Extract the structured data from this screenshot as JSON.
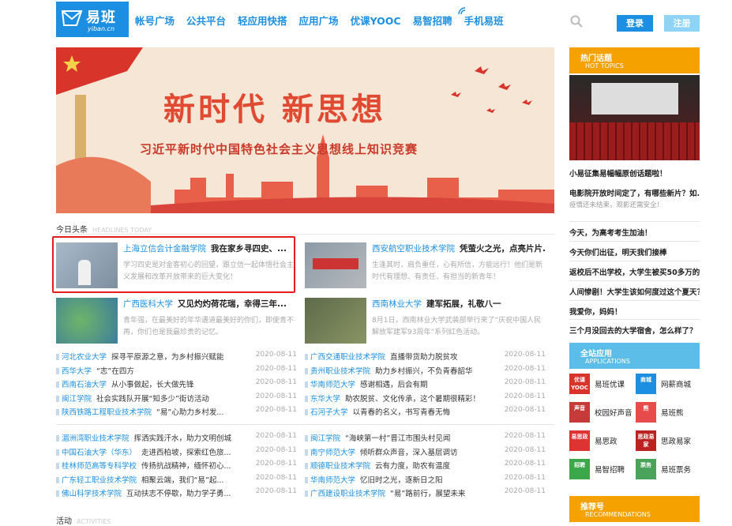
{
  "header": {
    "logo_text": "易班",
    "logo_sub": "yiban.cn",
    "nav": [
      "帐号广场",
      "公共平台",
      "轻应用快搭",
      "应用广场",
      "优课YOOC",
      "易智招聘",
      "手机易班"
    ],
    "login": "登录",
    "register": "注册"
  },
  "banner": {
    "title": "新时代 新思想",
    "subtitle": "习近平新时代中国特色社会主义思想线上知识竞赛"
  },
  "headlines": {
    "title": "今日头条",
    "title_en": "HEADLINES TODAY"
  },
  "cards": [
    {
      "school": "上海立信会计金融学院",
      "title": "我在家乡寻四史、...",
      "desc": "学习四史是对金客初心的回望，跟立信一起体悟社会主义发展和改革开放带来的巨大变化！"
    },
    {
      "school": "西安航空职业技术学院",
      "title": "凭萤火之光，点亮片片...",
      "desc": "生逢其时，肩负重任，心有所信，方能远行！他们是新时代有理想、有责任、有担当的新青年！"
    },
    {
      "school": "广西医科大学",
      "title": "又见灼灼荷花瑞，幸得三年...",
      "desc": "青年强，在最美好的年华遇道最美好的你们，即使青不再，你们也是我最珍贵的记忆。"
    },
    {
      "school": "西南林业大学",
      "title": "建军拓展，礼敬八一",
      "desc": "8月1日，西南林业大学武装部举行来了“庆祝中国人民解放军建军93周年”系列红色活动。"
    }
  ],
  "list_left_1": [
    {
      "school": "河北农业大学",
      "text": "探寻平原源之意，为乡村振兴赋能",
      "date": "2020-08-11"
    },
    {
      "school": "西华大学",
      "text": "“志”在四方",
      "date": "2020-08-11"
    },
    {
      "school": "西南石油大学",
      "text": "从小事做起，长大做先锋",
      "date": "2020-08-11"
    },
    {
      "school": "闽江学院",
      "text": "社会实践队开展“知多少”街访活动",
      "date": "2020-08-11"
    },
    {
      "school": "陕西铁路工程职业技术学院",
      "text": "“易”心助力乡村发...",
      "date": "2020-08-11"
    }
  ],
  "list_right_1": [
    {
      "school": "广西交通职业技术学院",
      "text": "直播带货助力脱贫攻",
      "date": "2020-08-11"
    },
    {
      "school": "贵州职业技术学院",
      "text": "助力乡村振兴，不负青春韶华",
      "date": "2020-08-11"
    },
    {
      "school": "华南师范大学",
      "text": "感谢相遇，后会有期",
      "date": "2020-08-11"
    },
    {
      "school": "东华大学",
      "text": "助农脱贫、文化传承，这个暑期很精彩！",
      "date": "2020-08-11"
    },
    {
      "school": "石河子大学",
      "text": "以青春的名义，书写青春无悔",
      "date": "2020-08-11"
    }
  ],
  "list_left_2": [
    {
      "school": "湄洲湾职业技术学院",
      "text": "挥洒实践汗水，助力文明创城",
      "date": "2020-08-11"
    },
    {
      "school": "中国石油大学（华东）",
      "text": "走进西柏坡，探索红色旅...",
      "date": "2020-08-11"
    },
    {
      "school": "桂林师范高等专科学校",
      "text": "传扬抗战精神，缅怀初心...",
      "date": "2020-08-11"
    },
    {
      "school": "广东轻工职业技术学院",
      "text": "相聚云端，我们“易”起...",
      "date": "2020-08-11"
    },
    {
      "school": "佛山科学技术学院",
      "text": "互动扶志不停歇，助力学子勇...",
      "date": "2020-08-11"
    }
  ],
  "list_right_2": [
    {
      "school": "闽江学院",
      "text": "“海峡第一村”晋江市围头村见闻",
      "date": "2020-08-11"
    },
    {
      "school": "南宁师范大学",
      "text": "倾听群众声音，深入基层调访",
      "date": "2020-08-11"
    },
    {
      "school": "顺德职业技术学院",
      "text": "云有力度，助农有温度",
      "date": "2020-08-11"
    },
    {
      "school": "华南师范大学",
      "text": "忆旧时之光，逐新日之阳",
      "date": "2020-08-11"
    },
    {
      "school": "广西建设职业技术学院",
      "text": "“易”路前行，展望未来",
      "date": "2020-08-11"
    }
  ],
  "activities": {
    "title": "活动",
    "title_en": "ACTIVITIES"
  },
  "sidebar": {
    "hot_title": "热门话题",
    "hot_title_en": "HOT TOPICS",
    "hot_items": [
      "小易征集易幅幅原创话题啦！",
      "电影院开放时间定了，有哪些新片？如...",
      "疫情还未结束，观影还需安全！",
      "今天，为高考考生加油！",
      "今天你们出征，明天我们接棒",
      "返校后不出学校，大学生被买50多万的...",
      "人间惨剧！大学生该如何度过这个夏天？",
      "我爱你，妈妈！",
      "三个月没回去的大学宿舍，怎么样了？"
    ],
    "apps_title": "全站应用",
    "apps_title_en": "APPLICATIONS",
    "apps": [
      {
        "name": "易班优课",
        "icon": "优课 YOOC",
        "color": "#d9342b"
      },
      {
        "name": "网薪商城",
        "icon": "商城",
        "color": "#1d8fe2"
      },
      {
        "name": "校园好声音",
        "icon": "声音",
        "color": "#c73a3a"
      },
      {
        "name": "易班熊",
        "icon": "熊",
        "color": "#e84b4b"
      },
      {
        "name": "易思政",
        "icon": "易思政",
        "color": "#d33"
      },
      {
        "name": "思政易家",
        "icon": "思政易家",
        "color": "#b22"
      },
      {
        "name": "易智招聘",
        "icon": "招聘",
        "color": "#3aa84b"
      },
      {
        "name": "易班票务",
        "icon": "票务",
        "color": "#4aa35a"
      }
    ],
    "rec_title": "推荐号",
    "rec_title_en": "RECOMMENDATIONS",
    "colors": {
      "orange": "#f5a100",
      "blue": "#5bbde8"
    }
  }
}
